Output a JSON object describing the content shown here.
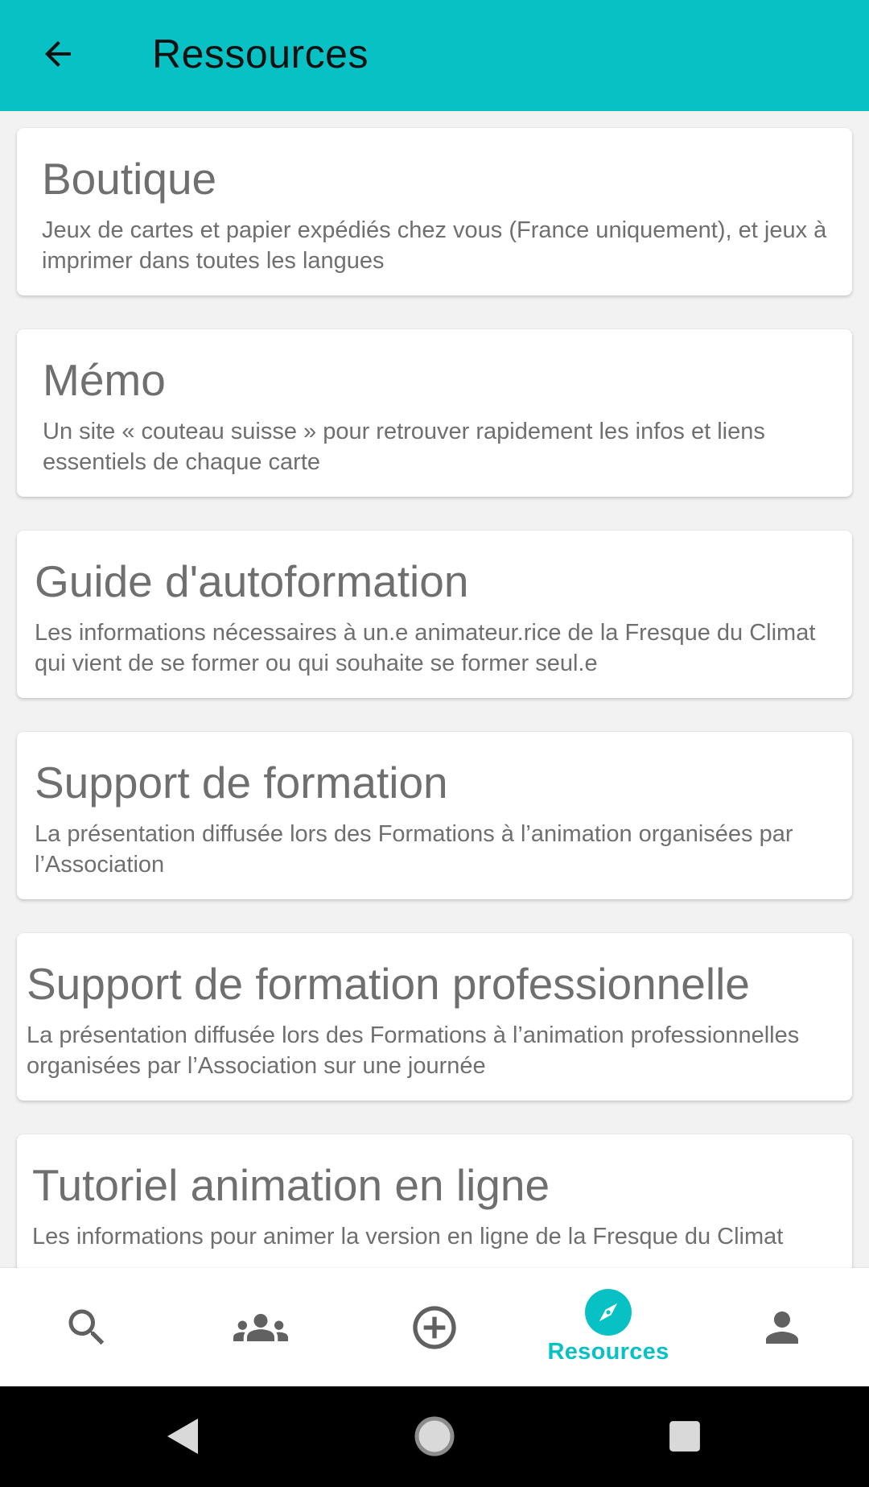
{
  "app_bar": {
    "title": "Ressources",
    "back_icon": "arrow-back-icon",
    "background_color": "#07c1c4"
  },
  "cards": [
    {
      "title": "Boutique",
      "description": "Jeux de cartes et papier expédiés chez vous (France uniquement), et jeux à imprimer dans toutes les langues"
    },
    {
      "title": "Mémo",
      "description": "Un site « couteau suisse » pour retrouver rapidement les infos et liens essentiels de chaque carte"
    },
    {
      "title": "Guide d'autoformation",
      "description": "Les informations nécessaires à un.e animateur.rice de la Fresque du Climat qui vient de se former ou qui souhaite se former seul.e"
    },
    {
      "title": "Support de formation",
      "description": "La présentation diffusée lors des Formations à l’animation organisées par l’Association"
    },
    {
      "title": "Support de formation professionnelle",
      "description": "La présentation diffusée lors des Formations à l’animation professionnelles organisées par l’Association sur une journée"
    },
    {
      "title": "Tutoriel animation en ligne",
      "description": "Les informations pour animer la version en ligne de la Fresque du Climat"
    }
  ],
  "bottom_nav": {
    "items": [
      {
        "icon": "search-icon",
        "label": ""
      },
      {
        "icon": "group-icon",
        "label": ""
      },
      {
        "icon": "add-circle-icon",
        "label": ""
      },
      {
        "icon": "compass-icon",
        "label": "Resources",
        "active": true
      },
      {
        "icon": "person-icon",
        "label": ""
      }
    ],
    "active_color": "#07c1c4",
    "inactive_color": "#616161"
  },
  "system_nav": {
    "items": [
      "back-triangle-icon",
      "home-circle-icon",
      "recents-square-icon"
    ]
  }
}
